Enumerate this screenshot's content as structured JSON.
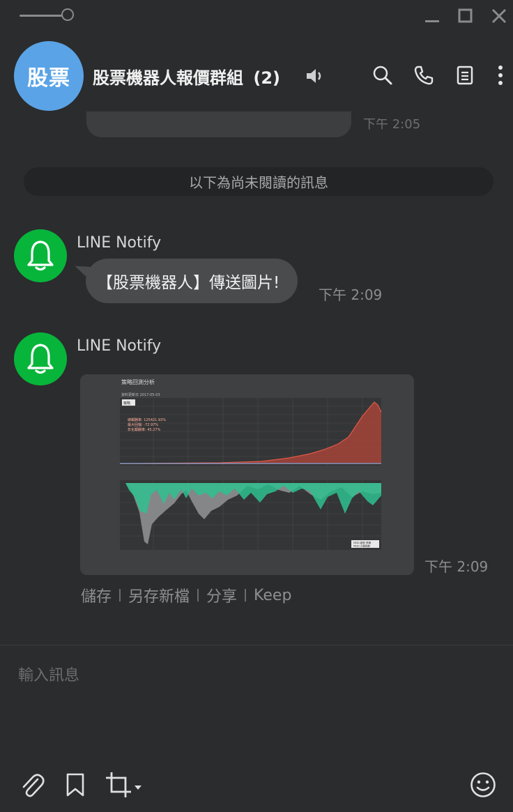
{
  "window": {
    "controls": [
      "slider-icon",
      "minimize-icon",
      "maximize-icon",
      "close-icon"
    ]
  },
  "header": {
    "avatar_text": "股票",
    "title": "股票機器人報價群組",
    "member_count": "(2)",
    "icons": [
      "speaker-icon",
      "search-icon",
      "phone-icon",
      "notes-icon",
      "more-icon"
    ]
  },
  "previous": {
    "time": "下午 2:05"
  },
  "unread_banner": "以下為尚未閱讀的訊息",
  "messages": [
    {
      "sender": "LINE Notify",
      "text": "【股票機器人】傳送圖片!",
      "time": "下午 2:09"
    },
    {
      "sender": "LINE Notify",
      "time": "下午 2:09",
      "image": {
        "title": "策略回測分析",
        "subtitle": "資料更新日 2017-05-03",
        "legend_box": "策略",
        "stats": [
          "總報酬率: 125421.93%",
          "最大回檔: -72.97%",
          "年化報酬率: 45.27%"
        ],
        "legend_bottom": [
          "MDD 趨勢 策略",
          "MDD 大盤指數"
        ]
      },
      "actions": [
        "儲存",
        "另存新檔",
        "分享",
        "Keep"
      ]
    }
  ],
  "composer": {
    "placeholder": "輸入訊息"
  },
  "toolbar": {
    "icons": [
      "paperclip-icon",
      "bookmark-icon",
      "crop-icon",
      "dropdown-arrow-icon",
      "emoji-icon"
    ]
  },
  "colors": {
    "notify_green": "#07b53b",
    "group_blue": "#5aa3e6",
    "background": "#2b2c2e",
    "bubble": "#4a4b4d"
  }
}
